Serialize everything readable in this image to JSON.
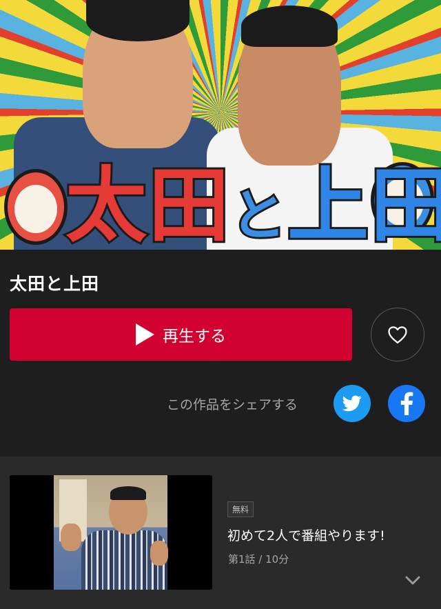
{
  "hero": {
    "title_art_chars": [
      "太",
      "田",
      "と",
      "上",
      "田"
    ]
  },
  "program": {
    "title": "太田と上田"
  },
  "actions": {
    "play_label": "再生する",
    "share_label": "この作品をシェアする"
  },
  "icons": {
    "play": "play-icon",
    "favorite": "heart-icon",
    "twitter": "twitter-icon",
    "facebook": "facebook-icon",
    "expand": "chevron-down-icon"
  },
  "colors": {
    "primary": "#d1022f",
    "background": "#1e1e1e",
    "list_background": "#2a2a2a",
    "twitter": "#1d9bf0",
    "facebook": "#1877f2"
  },
  "episodes": [
    {
      "badge": "無料",
      "title": "初めて2人で番組やります!",
      "meta": "第1話 / 10分"
    }
  ]
}
